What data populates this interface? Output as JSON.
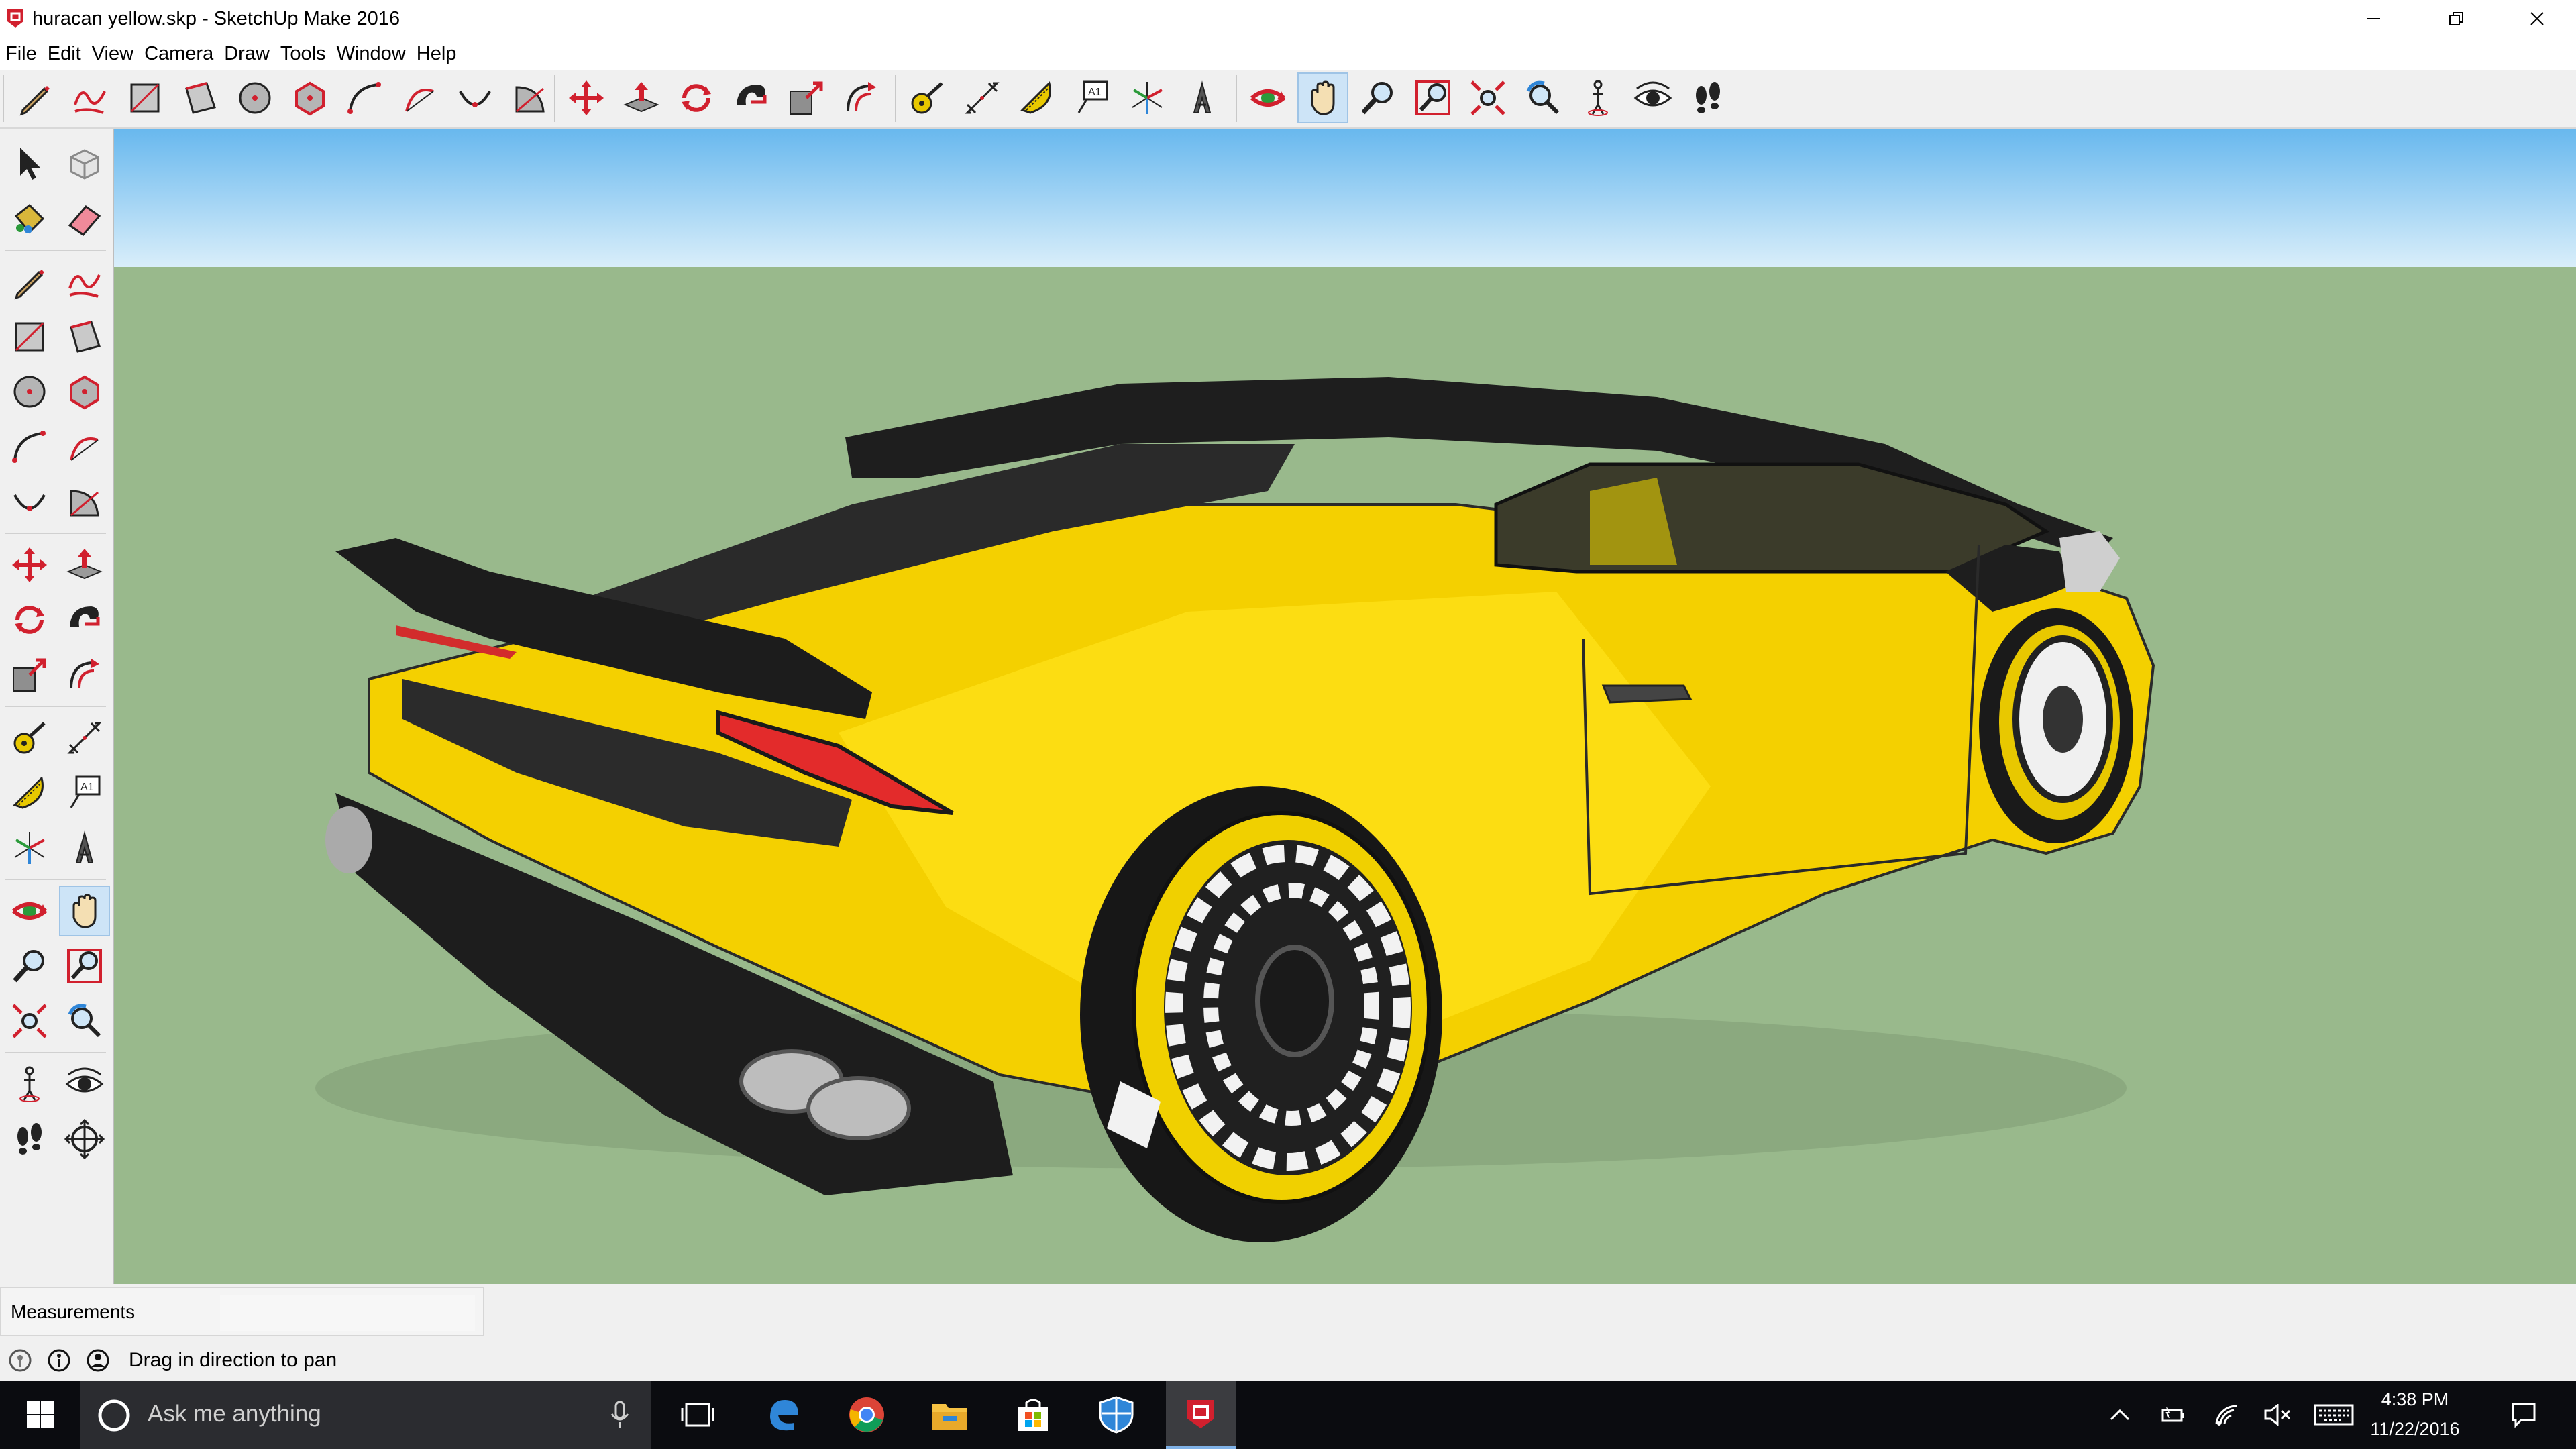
{
  "window": {
    "title": "huracan yellow.skp - SketchUp Make 2016",
    "app_icon": "sketchup-logo",
    "controls": [
      "minimize-icon",
      "restore-icon",
      "close-icon"
    ]
  },
  "menu": {
    "items": [
      "File",
      "Edit",
      "View",
      "Camera",
      "Draw",
      "Tools",
      "Window",
      "Help"
    ]
  },
  "toolbar": {
    "groups": [
      [
        "pencil-icon",
        "freehand-icon",
        "rectangle-icon",
        "rotated-rectangle-icon",
        "circle-icon",
        "polygon-icon",
        "arc-icon",
        "two-point-arc-icon",
        "three-point-arc-icon",
        "pie-icon"
      ],
      [
        "move-icon",
        "push-pull-icon",
        "rotate-icon",
        "follow-me-icon",
        "scale-icon",
        "offset-icon"
      ],
      [
        "tape-measure-icon",
        "dimensions-icon",
        "protractor-icon",
        "text-icon",
        "axes-icon",
        "3d-text-icon"
      ],
      [
        "orbit-icon",
        "pan-icon",
        "zoom-icon",
        "zoom-window-icon",
        "zoom-extents-icon",
        "previous-view-icon",
        "position-camera-icon",
        "look-around-icon",
        "walk-icon"
      ]
    ],
    "active_tool": "pan-icon",
    "text_tool_label": "A1"
  },
  "left_toolbar": {
    "tools": [
      "select-icon",
      "make-component-icon",
      "paint-bucket-icon",
      "eraser-icon",
      "pencil-icon",
      "freehand-icon",
      "rectangle-icon",
      "rotated-rectangle-icon",
      "circle-icon",
      "polygon-icon",
      "arc-icon",
      "two-point-arc-icon",
      "three-point-arc-icon",
      "pie-icon",
      "move-icon",
      "push-pull-icon",
      "rotate-icon",
      "follow-me-icon",
      "scale-icon",
      "offset-icon",
      "tape-measure-icon",
      "dimensions-icon",
      "protractor-icon",
      "text-icon",
      "axes-icon",
      "3d-text-icon",
      "orbit-icon",
      "pan-icon",
      "zoom-icon",
      "zoom-window-icon",
      "zoom-extents-icon",
      "previous-view-icon",
      "position-camera-icon",
      "look-around-icon",
      "walk-icon",
      "section-plane-icon"
    ],
    "active_tool": "pan-icon"
  },
  "viewport": {
    "model": "yellow-sports-car",
    "colors": {
      "sky_top": "#68b8ee",
      "sky_bottom": "#d9eefa",
      "ground": "#99b98c",
      "body": "#f4d000",
      "trim": "#222222"
    }
  },
  "measurements": {
    "label": "Measurements",
    "value": ""
  },
  "status": {
    "icons": [
      "geo-location-icon",
      "credits-icon",
      "user-icon"
    ],
    "text": "Drag in direction to pan"
  },
  "taskbar": {
    "search_placeholder": "Ask me anything",
    "apps": [
      "task-view-icon",
      "edge-icon",
      "chrome-icon",
      "file-explorer-icon",
      "store-icon",
      "security-icon",
      "sketchup-taskbar-icon"
    ],
    "tray": [
      "show-hidden-icons-icon",
      "power-icon",
      "wifi-icon",
      "volume-mute-icon",
      "keyboard-icon"
    ],
    "time": "4:38 PM",
    "date": "11/22/2016"
  }
}
